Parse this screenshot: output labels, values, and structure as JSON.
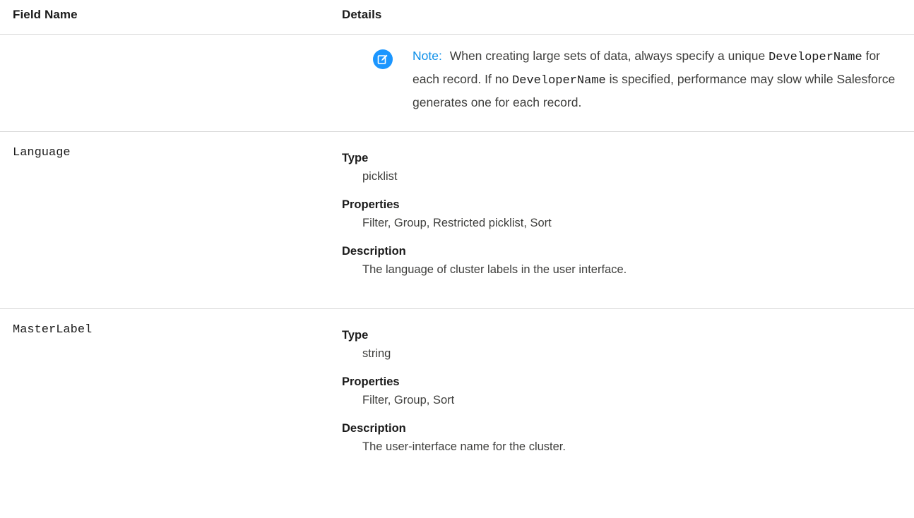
{
  "table": {
    "header": {
      "field_name": "Field Name",
      "details": "Details"
    },
    "note": {
      "label": "Note:",
      "text_1": "When creating large sets of data, always specify a unique",
      "code_1": "DeveloperName",
      "text_2": "for each record. If no",
      "code_2": "DeveloperName",
      "text_3": "is specified, performance may slow while Salesforce generates one for each record.",
      "icon": "edit-note-icon",
      "icon_color": "#1b96ff",
      "label_color": "#0b8ee8"
    },
    "rows": [
      {
        "field": "Language",
        "type_label": "Type",
        "type": "picklist",
        "properties_label": "Properties",
        "properties": "Filter, Group, Restricted picklist, Sort",
        "description_label": "Description",
        "description": "The language of cluster labels in the user interface."
      },
      {
        "field": "MasterLabel",
        "type_label": "Type",
        "type": "string",
        "properties_label": "Properties",
        "properties": "Filter, Group, Sort",
        "description_label": "Description",
        "description": "The user-interface name for the cluster."
      }
    ]
  }
}
